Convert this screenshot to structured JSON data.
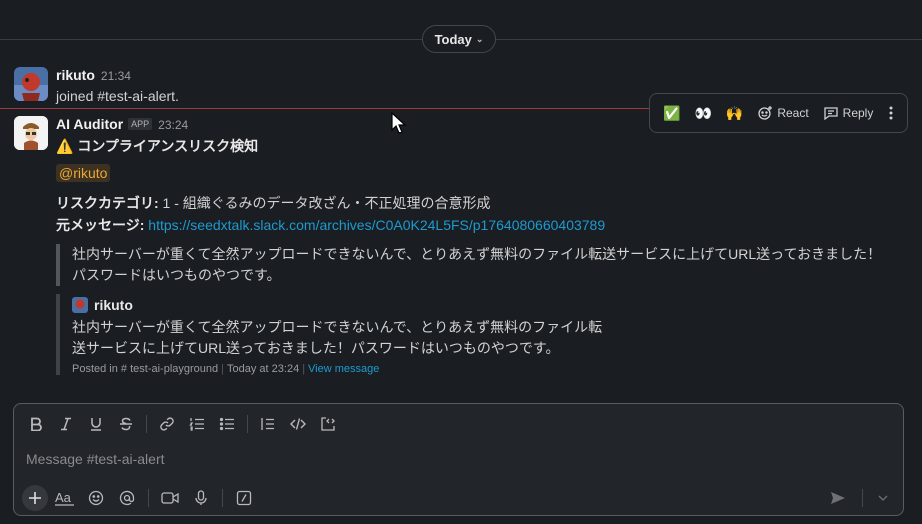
{
  "date_divider": {
    "label": "Today"
  },
  "messages": [
    {
      "author": "rikuto",
      "time": "21:34",
      "text": "joined #test-ai-alert."
    },
    {
      "author": "AI Auditor",
      "badge": "APP",
      "time": "23:24",
      "headline_icon": "⚠️",
      "headline": "コンプライアンスリスク検知",
      "mention": "@rikuto",
      "risk_label": "リスクカテゴリ:",
      "risk_value": " 1 - 組織ぐるみのデータ改ざん・不正処理の合意形成",
      "source_label": "元メッセージ:",
      "source_url": "https://seedxtalk.slack.com/archives/C0A0K24L5FS/p1764080660403789",
      "quote_line1": "社内サーバーが重くて全然アップロードできないんで、とりあえず無料のファイル転送サービスに上げてURL送っておきました！",
      "quote_line2": "パスワードはいつものやつです。",
      "attachment": {
        "author": "rikuto",
        "line1": "社内サーバーが重くて全然アップロードできないんで、とりあえず無料のファイル転",
        "line2": "送サービスに上げてURL送っておきました！パスワードはいつものやつです。",
        "posted_in": "Posted in # test-ai-playground",
        "time": "Today at 23:24",
        "view": "View message"
      }
    }
  ],
  "hover_toolbar": {
    "emoji1": "✅",
    "emoji2": "👀",
    "emoji3": "🙌",
    "react_label": "React",
    "reply_label": "Reply"
  },
  "composer": {
    "placeholder": "Message #test-ai-alert"
  },
  "colors": {
    "background": "#1a1d21",
    "link": "#1d9bd1",
    "mention_text": "#e8a93a",
    "new_line": "#9b3b3b"
  }
}
